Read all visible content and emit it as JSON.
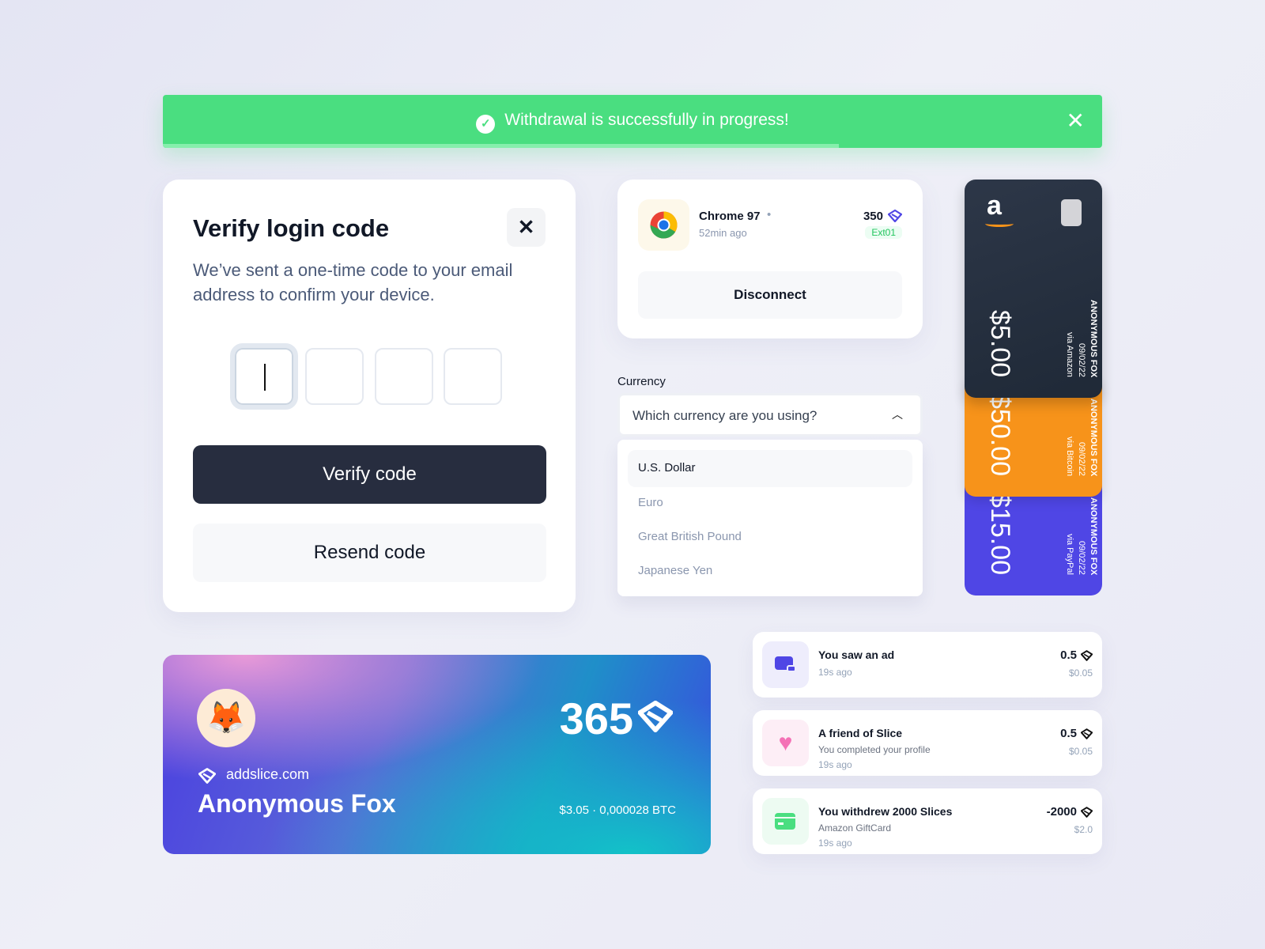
{
  "banner": {
    "message": "Withdrawal is successfully in progress!",
    "progress_percent": 72,
    "close_icon": "close-icon",
    "check_icon": "check-circle-icon",
    "color": "#4ade80"
  },
  "verify": {
    "title": "Verify login code",
    "subtitle": "We’ve sent a one-time code to your email address to confirm your device.",
    "code_digits": [
      "",
      "",
      "",
      ""
    ],
    "verify_label": "Verify code",
    "resend_label": "Resend code"
  },
  "session": {
    "browser": "Chrome 97",
    "os_icon": "apple-icon",
    "time": "52min ago",
    "points": "350",
    "tag": "Ext01",
    "disconnect_label": "Disconnect"
  },
  "currency": {
    "label": "Currency",
    "placeholder": "Which currency are you using?",
    "options": [
      "U.S. Dollar",
      "Euro",
      "Great British Pound",
      "Japanese Yen"
    ],
    "highlighted": "U.S. Dollar"
  },
  "giftcards": [
    {
      "amount": "$5.00",
      "name": "ANONYMOUS FOX",
      "date": "09/02/22",
      "via": "via Amazon",
      "color": "#1f2937"
    },
    {
      "amount": "$50.00",
      "name": "ANONYMOUS FOX",
      "date": "09/02/22",
      "via": "via Bitcoin",
      "color": "#f7931a"
    },
    {
      "amount": "$15.00",
      "name": "ANONYMOUS FOX",
      "date": "09/02/22",
      "via": "via PayPal",
      "color": "#4f46e5"
    }
  ],
  "profile": {
    "points": "365",
    "site": "addslice.com",
    "name": "Anonymous Fox",
    "balance": "$3.05 · 0,000028 BTC",
    "avatar": "🦊"
  },
  "activity": [
    {
      "title": "You saw an ad",
      "detail": "",
      "time": "19s ago",
      "value": "0.5",
      "usd": "$0.05",
      "icon": "ad-icon",
      "icon_bg": "#eeedfc",
      "icon_color": "#4f46e5"
    },
    {
      "title": "A friend of Slice",
      "detail": "You completed your profile",
      "time": "19s ago",
      "value": "0.5",
      "usd": "$0.05",
      "icon": "heart-icon",
      "icon_bg": "#fdeef6",
      "icon_color": "#f472b6"
    },
    {
      "title": "You withdrew 2000 Slices",
      "detail": "Amazon GiftCard",
      "time": "19s ago",
      "value": "-2000",
      "usd": "$2.0",
      "icon": "credit-card-icon",
      "icon_bg": "#edfbf2",
      "icon_color": "#4ade80"
    }
  ]
}
